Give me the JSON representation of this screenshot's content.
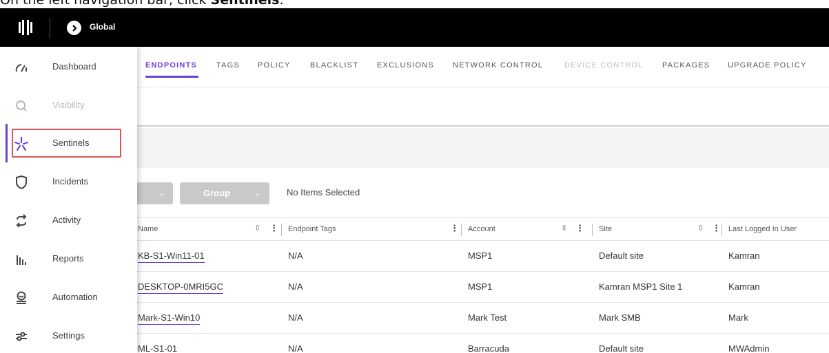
{
  "caption": {
    "prefix": "On the left navigation bar, click ",
    "target": "Sentinels",
    "suffix": "."
  },
  "topbar": {
    "scope_label": "Global"
  },
  "sidebar": {
    "items": [
      {
        "label": "Dashboard",
        "icon": "gauge-icon"
      },
      {
        "label": "Visibility",
        "icon": "magnifier-icon"
      },
      {
        "label": "Sentinels",
        "icon": "asterisk-icon"
      },
      {
        "label": "Incidents",
        "icon": "shield-icon"
      },
      {
        "label": "Activity",
        "icon": "arrows-icon"
      },
      {
        "label": "Reports",
        "icon": "bar-chart-icon"
      },
      {
        "label": "Automation",
        "icon": "automation-icon"
      },
      {
        "label": "Settings",
        "icon": "sliders-icon"
      }
    ]
  },
  "tabs": [
    "ENDPOINTS",
    "TAGS",
    "POLICY",
    "BLACKLIST",
    "EXCLUSIONS",
    "NETWORK CONTROL",
    "DEVICE CONTROL",
    "PACKAGES",
    "UPGRADE POLICY"
  ],
  "toolbar": {
    "group_label": "Group",
    "selection_status": "No Items Selected"
  },
  "table": {
    "headers": [
      "Name",
      "Endpoint Tags",
      "Account",
      "Site",
      "Last Logged In User"
    ],
    "rows": [
      [
        "KB-S1-Win11-01",
        "N/A",
        "MSP1",
        "Default site",
        "Kamran"
      ],
      [
        "DESKTOP-0MRI5GC",
        "N/A",
        "MSP1",
        "Kamran MSP1 Site 1",
        "Kamran"
      ],
      [
        "Mark-S1-Win10",
        "N/A",
        "Mark Test",
        "Mark SMB",
        "Mark"
      ],
      [
        "ML-S1-01",
        "N/A",
        "Barracuda",
        "Default site",
        "MWAdmin"
      ]
    ]
  },
  "colors": {
    "accent": "#6b3fd6",
    "highlight": "#e05353",
    "topbar": "#000000"
  }
}
